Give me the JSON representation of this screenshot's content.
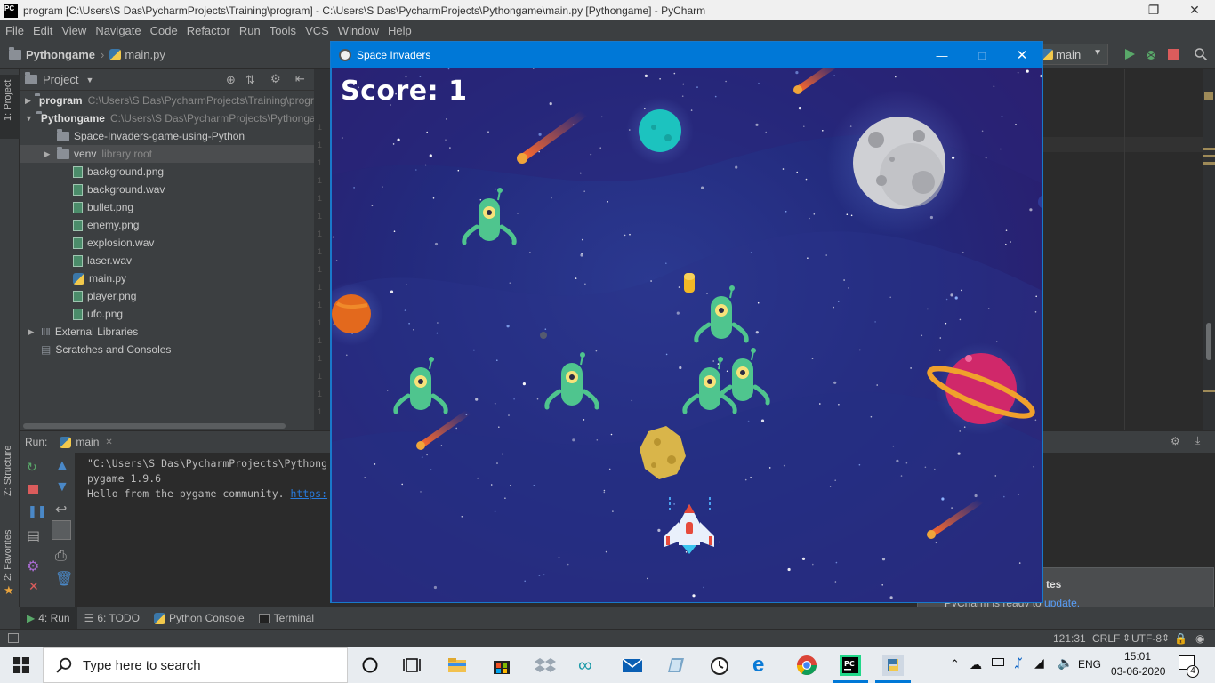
{
  "window": {
    "title": "program [C:\\Users\\S Das\\PycharmProjects\\Training\\program] - C:\\Users\\S Das\\PycharmProjects\\Pythongame\\main.py [Pythongame] - PyCharm",
    "logo_text": "PC"
  },
  "menu": [
    "File",
    "Edit",
    "View",
    "Navigate",
    "Code",
    "Refactor",
    "Run",
    "Tools",
    "VCS",
    "Window",
    "Help"
  ],
  "navbar": {
    "project": "Pythongame",
    "file": "main.py",
    "run_config": "main"
  },
  "project_panel": {
    "title": "Project",
    "tree": [
      {
        "label": "program",
        "hint": "C:\\Users\\S Das\\PycharmProjects\\Training\\program",
        "bold": true,
        "expanded": false,
        "icon": "folder-icon",
        "indent": 0
      },
      {
        "label": "Pythongame",
        "hint": "C:\\Users\\S Das\\PycharmProjects\\Pythongame",
        "bold": true,
        "expanded": true,
        "icon": "folder-icon",
        "indent": 0
      },
      {
        "label": "Space-Invaders-game-using-Python",
        "hint": "",
        "bold": false,
        "expanded": null,
        "icon": "folder-icon",
        "indent": 1
      },
      {
        "label": "venv",
        "hint": "library root",
        "bold": false,
        "expanded": false,
        "icon": "folder-icon",
        "indent": 1,
        "selected": true
      },
      {
        "label": "background.png",
        "hint": "",
        "bold": false,
        "expanded": null,
        "icon": "image-file-icon",
        "indent": 2
      },
      {
        "label": "background.wav",
        "hint": "",
        "bold": false,
        "expanded": null,
        "icon": "audio-file-icon",
        "indent": 2
      },
      {
        "label": "bullet.png",
        "hint": "",
        "bold": false,
        "expanded": null,
        "icon": "image-file-icon",
        "indent": 2
      },
      {
        "label": "enemy.png",
        "hint": "",
        "bold": false,
        "expanded": null,
        "icon": "image-file-icon",
        "indent": 2
      },
      {
        "label": "explosion.wav",
        "hint": "",
        "bold": false,
        "expanded": null,
        "icon": "audio-file-icon",
        "indent": 2
      },
      {
        "label": "laser.wav",
        "hint": "",
        "bold": false,
        "expanded": null,
        "icon": "audio-file-icon",
        "indent": 2
      },
      {
        "label": "main.py",
        "hint": "",
        "bold": false,
        "expanded": null,
        "icon": "python-file-icon",
        "indent": 2
      },
      {
        "label": "player.png",
        "hint": "",
        "bold": false,
        "expanded": null,
        "icon": "image-file-icon",
        "indent": 2
      },
      {
        "label": "ufo.png",
        "hint": "",
        "bold": false,
        "expanded": null,
        "icon": "image-file-icon",
        "indent": 2
      },
      {
        "label": "External Libraries",
        "hint": "",
        "bold": false,
        "expanded": false,
        "icon": "library-icon",
        "indent": 0
      },
      {
        "label": "Scratches and Consoles",
        "hint": "",
        "bold": false,
        "expanded": null,
        "icon": "scratches-icon",
        "indent": 0
      }
    ]
  },
  "side_tabs": {
    "project": "1: Project",
    "structure": "Z: Structure",
    "favorites": "2: Favorites"
  },
  "run_panel": {
    "label": "Run:",
    "tab": "main",
    "console_lines": [
      "\"C:\\Users\\S Das\\PycharmProjects\\Pythong",
      "pygame 1.9.6",
      "Hello from the pygame community. "
    ],
    "console_link": "https:"
  },
  "bottom_tabs": [
    {
      "label": "4: Run",
      "icon": "run-icon",
      "active": true
    },
    {
      "label": "6: TODO",
      "icon": "todo-icon",
      "active": false
    },
    {
      "label": "Python Console",
      "icon": "python-console-icon",
      "active": false
    },
    {
      "label": "Terminal",
      "icon": "terminal-icon",
      "active": false
    }
  ],
  "status_bar": {
    "position": "121:31",
    "line_sep": "CRLF",
    "encoding": "UTF-8"
  },
  "notification": {
    "title": "tes",
    "text": "PyCharm is ready to ",
    "link": "update."
  },
  "game": {
    "title": "Space Invaders",
    "score": "Score: 1"
  },
  "taskbar": {
    "search_placeholder": "Type here to search",
    "language": "ENG",
    "time": "15:01",
    "date": "03-06-2020",
    "notification_count": "4"
  }
}
